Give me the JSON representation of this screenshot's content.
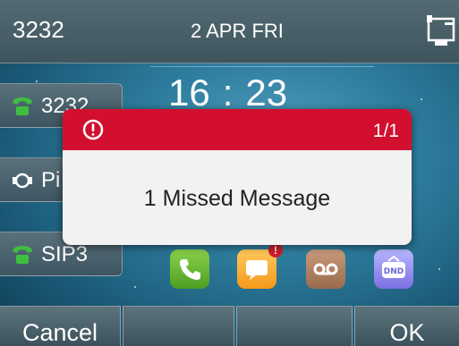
{
  "status_bar": {
    "extension": "3232",
    "date": "2 APR FRI",
    "network_icon": "network-ethernet-icon"
  },
  "clock": {
    "hours": "16",
    "separator": ":",
    "minutes": "23"
  },
  "line_keys": [
    {
      "label": "3232",
      "icon": "phone-icon"
    },
    {
      "label": "Pi",
      "icon": "pickup-icon"
    },
    {
      "label": "SIP3",
      "icon": "phone-icon"
    }
  ],
  "apps": [
    {
      "name": "call",
      "icon": "phone-icon"
    },
    {
      "name": "messages",
      "icon": "message-icon",
      "badge": "!"
    },
    {
      "name": "voicemail",
      "icon": "voicemail-icon"
    },
    {
      "name": "dnd",
      "icon": "dnd-icon",
      "text": "DND"
    }
  ],
  "popup": {
    "count": "1/1",
    "message": "1 Missed Message",
    "header_color": "#d20f2e"
  },
  "soft_keys": [
    "Cancel",
    "",
    "",
    "OK"
  ]
}
